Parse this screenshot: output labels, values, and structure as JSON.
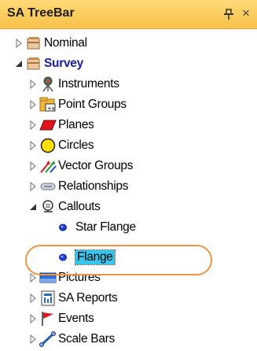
{
  "window": {
    "title": "SA TreeBar"
  },
  "tree": {
    "nominal": "Nominal",
    "survey": "Survey",
    "instruments": "Instruments",
    "point_groups": "Point Groups",
    "planes": "Planes",
    "circles": "Circles",
    "vector_groups": "Vector Groups",
    "relationships": "Relationships",
    "callouts": "Callouts",
    "star_flange": "Star Flange",
    "flange": "Flange",
    "pictures": "Pictures",
    "sa_reports": "SA Reports",
    "events": "Events",
    "scale_bars": "Scale Bars"
  },
  "icons": {
    "nominal": "folder-stack-icon",
    "survey": "folder-stack-icon",
    "instruments": "instrument-icon",
    "point_groups": "point-group-icon",
    "planes": "plane-icon",
    "circles": "circle-icon",
    "vector_groups": "vector-icon",
    "relationships": "relationship-icon",
    "callouts": "callout-icon",
    "callout_item": "blue-dot-icon",
    "pictures": "picture-icon",
    "sa_reports": "report-icon",
    "events": "flag-icon",
    "scale_bars": "scale-bar-icon"
  },
  "colors": {
    "title_bar": "#f7c24a",
    "selection": "#35c6ee",
    "annotation": "#ee9444",
    "survey_text": "#1a1aa6"
  }
}
